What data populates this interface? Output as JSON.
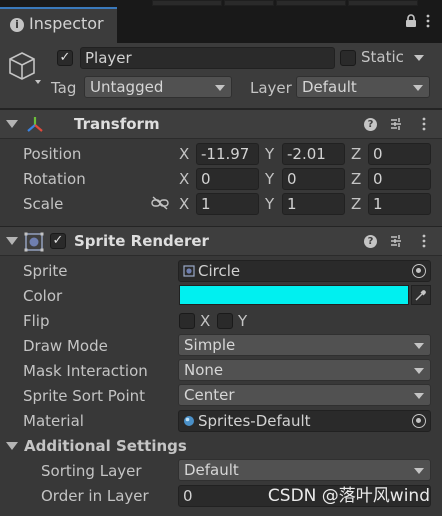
{
  "tab": {
    "title": "Inspector",
    "lock_icon": "lock-icon",
    "menu_icon": "more-menu-icon"
  },
  "object": {
    "active": true,
    "name": "Player",
    "static_label": "Static",
    "static_checked": false,
    "tag_label": "Tag",
    "tag_value": "Untagged",
    "layer_label": "Layer",
    "layer_value": "Default"
  },
  "transform": {
    "title": "Transform",
    "position": {
      "label": "Position",
      "x": "-11.97",
      "y": "-2.01",
      "z": "0"
    },
    "rotation": {
      "label": "Rotation",
      "x": "0",
      "y": "0",
      "z": "0"
    },
    "scale": {
      "label": "Scale",
      "x": "1",
      "y": "1",
      "z": "1"
    },
    "axis_x": "X",
    "axis_y": "Y",
    "axis_z": "Z"
  },
  "sprite_renderer": {
    "title": "Sprite Renderer",
    "enabled": true,
    "sprite_label": "Sprite",
    "sprite_value": "Circle",
    "color_label": "Color",
    "color_value": "#00f0f0",
    "flip_label": "Flip",
    "flip_x": "X",
    "flip_y": "Y",
    "draw_mode_label": "Draw Mode",
    "draw_mode_value": "Simple",
    "mask_label": "Mask Interaction",
    "mask_value": "None",
    "sort_point_label": "Sprite Sort Point",
    "sort_point_value": "Center",
    "material_label": "Material",
    "material_value": "Sprites-Default",
    "additional_label": "Additional Settings",
    "sorting_layer_label": "Sorting Layer",
    "sorting_layer_value": "Default",
    "order_label": "Order in Layer",
    "order_value": "0"
  },
  "watermark": "CSDN @落叶风wind",
  "colors": {
    "accent": "#3a79bb",
    "panel": "#383838",
    "header": "#3e3e3e"
  }
}
